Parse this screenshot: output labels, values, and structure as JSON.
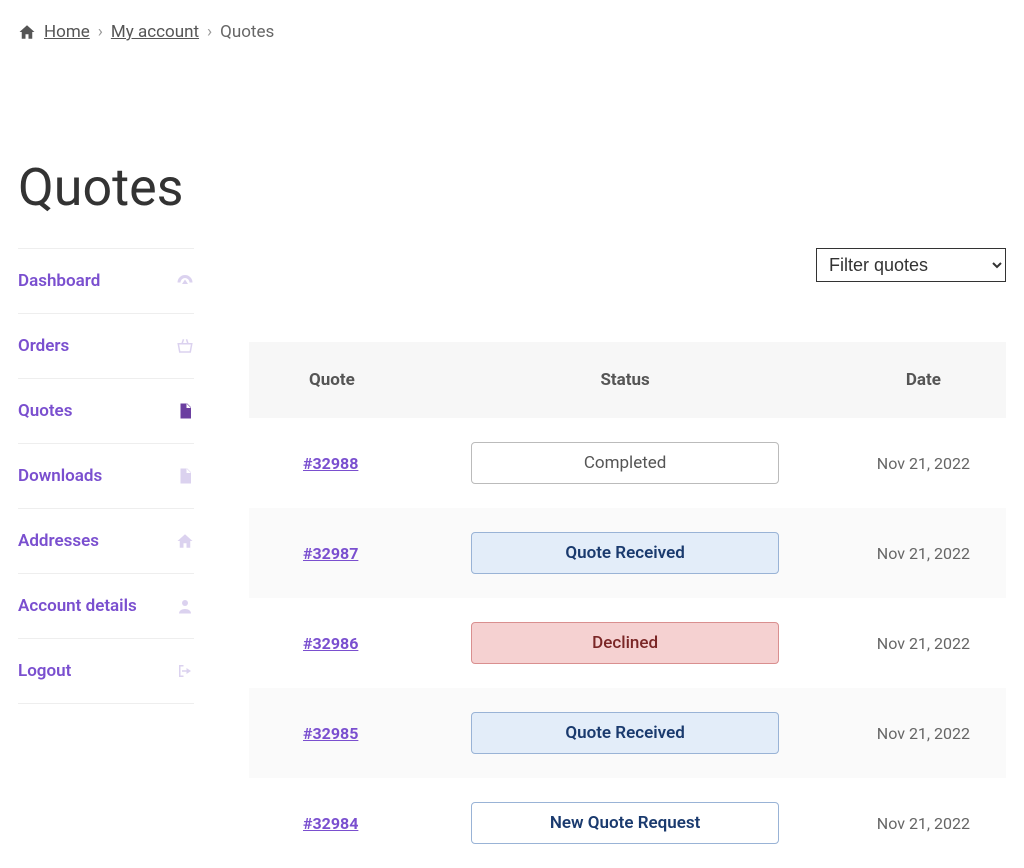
{
  "breadcrumb": {
    "home": "Home",
    "my_account": "My account",
    "current": "Quotes"
  },
  "page_title": "Quotes",
  "sidebar": {
    "items": [
      {
        "label": "Dashboard",
        "icon": "gauge-icon",
        "active": false
      },
      {
        "label": "Orders",
        "icon": "basket-icon",
        "active": false
      },
      {
        "label": "Quotes",
        "icon": "file-icon",
        "active": true
      },
      {
        "label": "Downloads",
        "icon": "file-arrow-icon",
        "active": false
      },
      {
        "label": "Addresses",
        "icon": "home-icon",
        "active": false
      },
      {
        "label": "Account details",
        "icon": "user-icon",
        "active": false
      },
      {
        "label": "Logout",
        "icon": "sign-out-icon",
        "active": false
      }
    ]
  },
  "filter": {
    "selected": "Filter quotes"
  },
  "table": {
    "headers": {
      "quote": "Quote",
      "status": "Status",
      "date": "Date"
    },
    "rows": [
      {
        "id": "#32988",
        "status": "Completed",
        "status_class": "status-completed",
        "date": "Nov 21, 2022"
      },
      {
        "id": "#32987",
        "status": "Quote Received",
        "status_class": "status-received",
        "date": "Nov 21, 2022"
      },
      {
        "id": "#32986",
        "status": "Declined",
        "status_class": "status-declined",
        "date": "Nov 21, 2022"
      },
      {
        "id": "#32985",
        "status": "Quote Received",
        "status_class": "status-received",
        "date": "Nov 21, 2022"
      },
      {
        "id": "#32984",
        "status": "New Quote Request",
        "status_class": "status-newrequest",
        "date": "Nov 21, 2022"
      }
    ]
  }
}
